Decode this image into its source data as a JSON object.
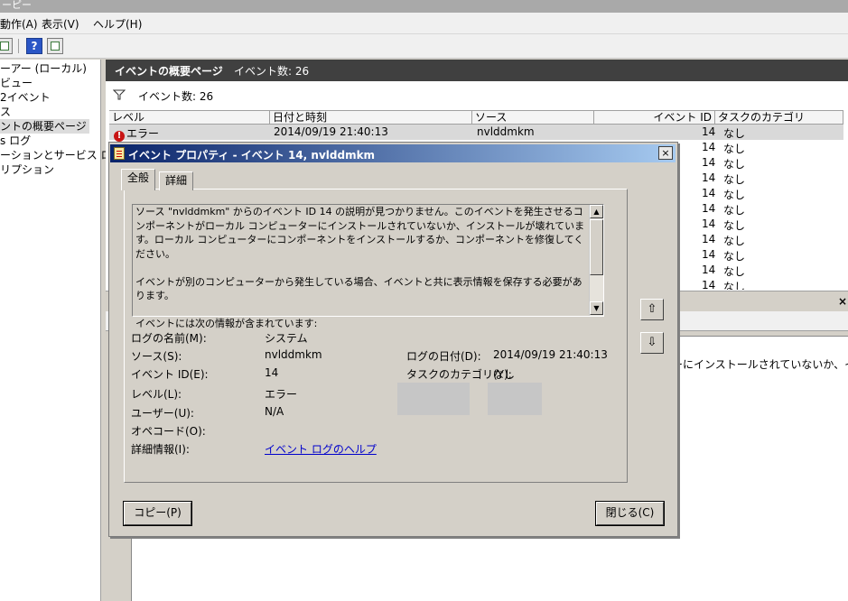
{
  "window": {
    "title_fragment": "ーピー"
  },
  "menu": {
    "action": "動作(A)",
    "view": "表示(V)",
    "help": "ヘルプ(H)"
  },
  "tree": {
    "items": [
      "ーアー (ローカル)",
      "ビュー",
      "2イベント",
      "ス",
      "ントの概要ページ",
      "s ログ",
      "ーションとサービス ログ",
      "リプション"
    ]
  },
  "summary": {
    "title": "イベントの概要ページ",
    "event_count": "イベント数: 26",
    "filter_count": "イベント数: 26"
  },
  "grid": {
    "headers": [
      "レベル",
      "日付と時刻",
      "ソース",
      "イベント ID",
      "タスクのカテゴリ"
    ],
    "first_row": {
      "level": "エラー",
      "datetime": "2014/09/19 21:40:13",
      "source": "nvlddmkm",
      "event_id": "14",
      "category": "なし"
    },
    "rows": [
      {
        "event_id": "14",
        "category": "なし"
      },
      {
        "event_id": "14",
        "category": "なし"
      },
      {
        "event_id": "14",
        "category": "なし"
      },
      {
        "event_id": "14",
        "category": "なし"
      },
      {
        "event_id": "14",
        "category": "なし"
      },
      {
        "event_id": "14",
        "category": "なし"
      },
      {
        "event_id": "14",
        "category": "なし"
      },
      {
        "event_id": "14",
        "category": "なし"
      },
      {
        "event_id": "14",
        "category": "なし"
      },
      {
        "event_id": "14",
        "category": "なし"
      },
      {
        "event_id": "14",
        "category": "なし"
      }
    ]
  },
  "lower": {
    "text_fragment": "ーにインストールされていないか、イ",
    "close": "×"
  },
  "dialog": {
    "title": "イベント プロパティ - イベント 14, nvlddmkm",
    "close": "×",
    "tabs": {
      "general": "全般",
      "details": "詳細"
    },
    "description": [
      "ソース \"nvlddmkm\" からのイベント ID 14 の説明が見つかりません。このイベントを発生させるコンポーネントがローカル コンピューターにインストールされていないか、インストールが壊れています。ローカル コンピューターにコンポーネントをインストールするか、コンポーネントを修復してください。",
      "イベントが別のコンピューターから発生している場合、イベントと共に表示情報を保存する必要があります。",
      "イベントには次の情報が含まれています:"
    ],
    "fields": {
      "log_name_label": "ログの名前(M):",
      "log_name": "システム",
      "source_label": "ソース(S):",
      "source": "nvlddmkm",
      "logged_label": "ログの日付(D):",
      "logged": "2014/09/19 21:40:13",
      "event_id_label": "イベント ID(E):",
      "event_id": "14",
      "category_label": "タスクのカテゴリ(Y):",
      "category": "なし",
      "level_label": "レベル(L):",
      "level": "エラー",
      "user_label": "ユーザー(U):",
      "user": "N/A",
      "opcode_label": "オペコード(O):",
      "more_info_label": "詳細情報(I):",
      "more_info_link": "イベント ログのヘルプ"
    },
    "buttons": {
      "copy": "コピー(P)",
      "close": "閉じる(C)"
    }
  }
}
